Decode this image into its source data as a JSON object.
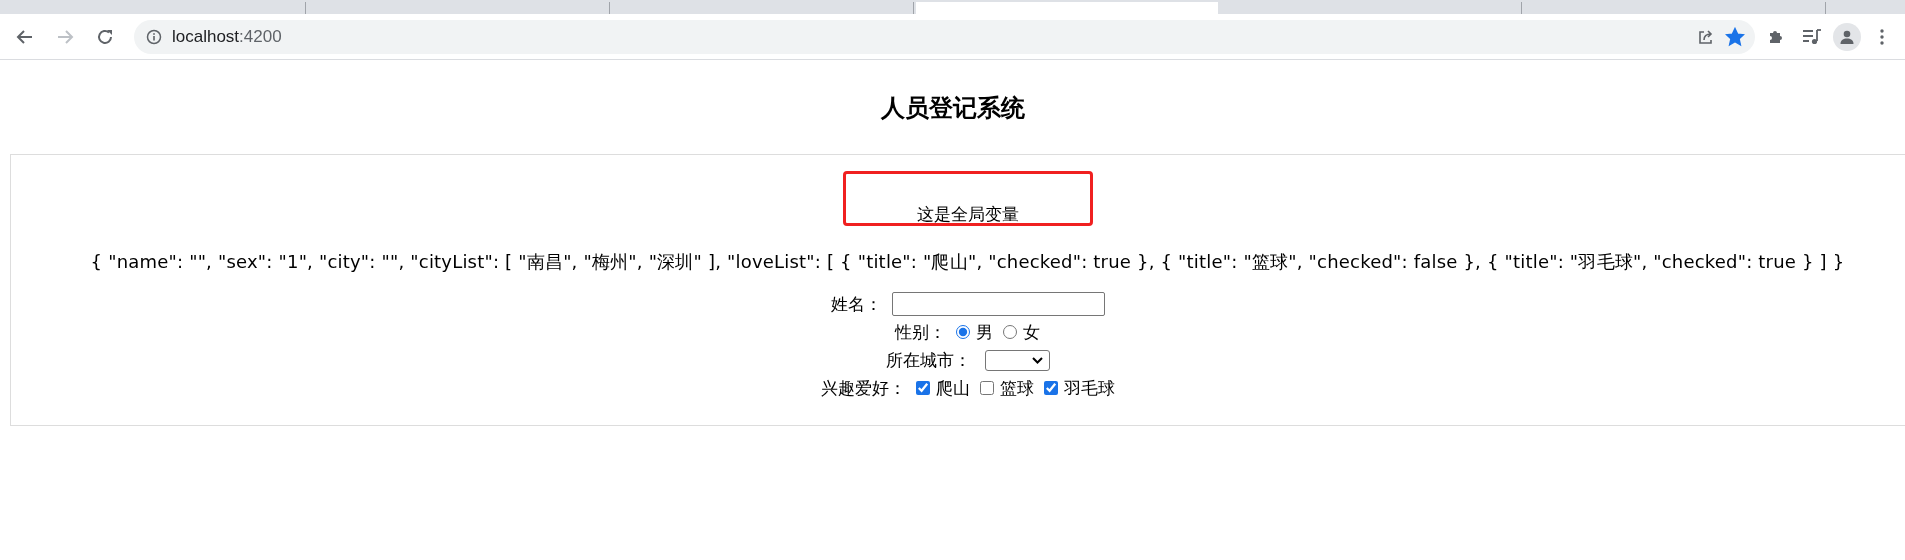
{
  "browser": {
    "tabs": [
      {
        "selected": false
      },
      {
        "selected": false
      },
      {
        "selected": false
      },
      {
        "selected": true
      },
      {
        "selected": false
      },
      {
        "selected": false
      }
    ],
    "forward_disabled": true,
    "address": {
      "host": "localhost",
      "port": ":4200"
    },
    "bookmarked": true
  },
  "page": {
    "title": "人员登记系统",
    "global_var": "这是全局变量",
    "model_json": "{ \"name\": \"\", \"sex\": \"1\", \"city\": \"\", \"cityList\": [ \"南昌\", \"梅州\", \"深圳\" ], \"loveList\": [ { \"title\": \"爬山\", \"checked\": true }, { \"title\": \"篮球\", \"checked\": false }, { \"title\": \"羽毛球\", \"checked\": true } ] }",
    "form": {
      "name": {
        "label": "姓名："
      },
      "sex": {
        "label": "性别：",
        "options": [
          {
            "label": "男",
            "selected": true
          },
          {
            "label": "女",
            "selected": false
          }
        ]
      },
      "city": {
        "label": "所在城市："
      },
      "hobbies": {
        "label": "兴趣爱好：",
        "items": [
          {
            "label": "爬山",
            "checked": true
          },
          {
            "label": "篮球",
            "checked": false
          },
          {
            "label": "羽毛球",
            "checked": true
          }
        ]
      }
    }
  }
}
